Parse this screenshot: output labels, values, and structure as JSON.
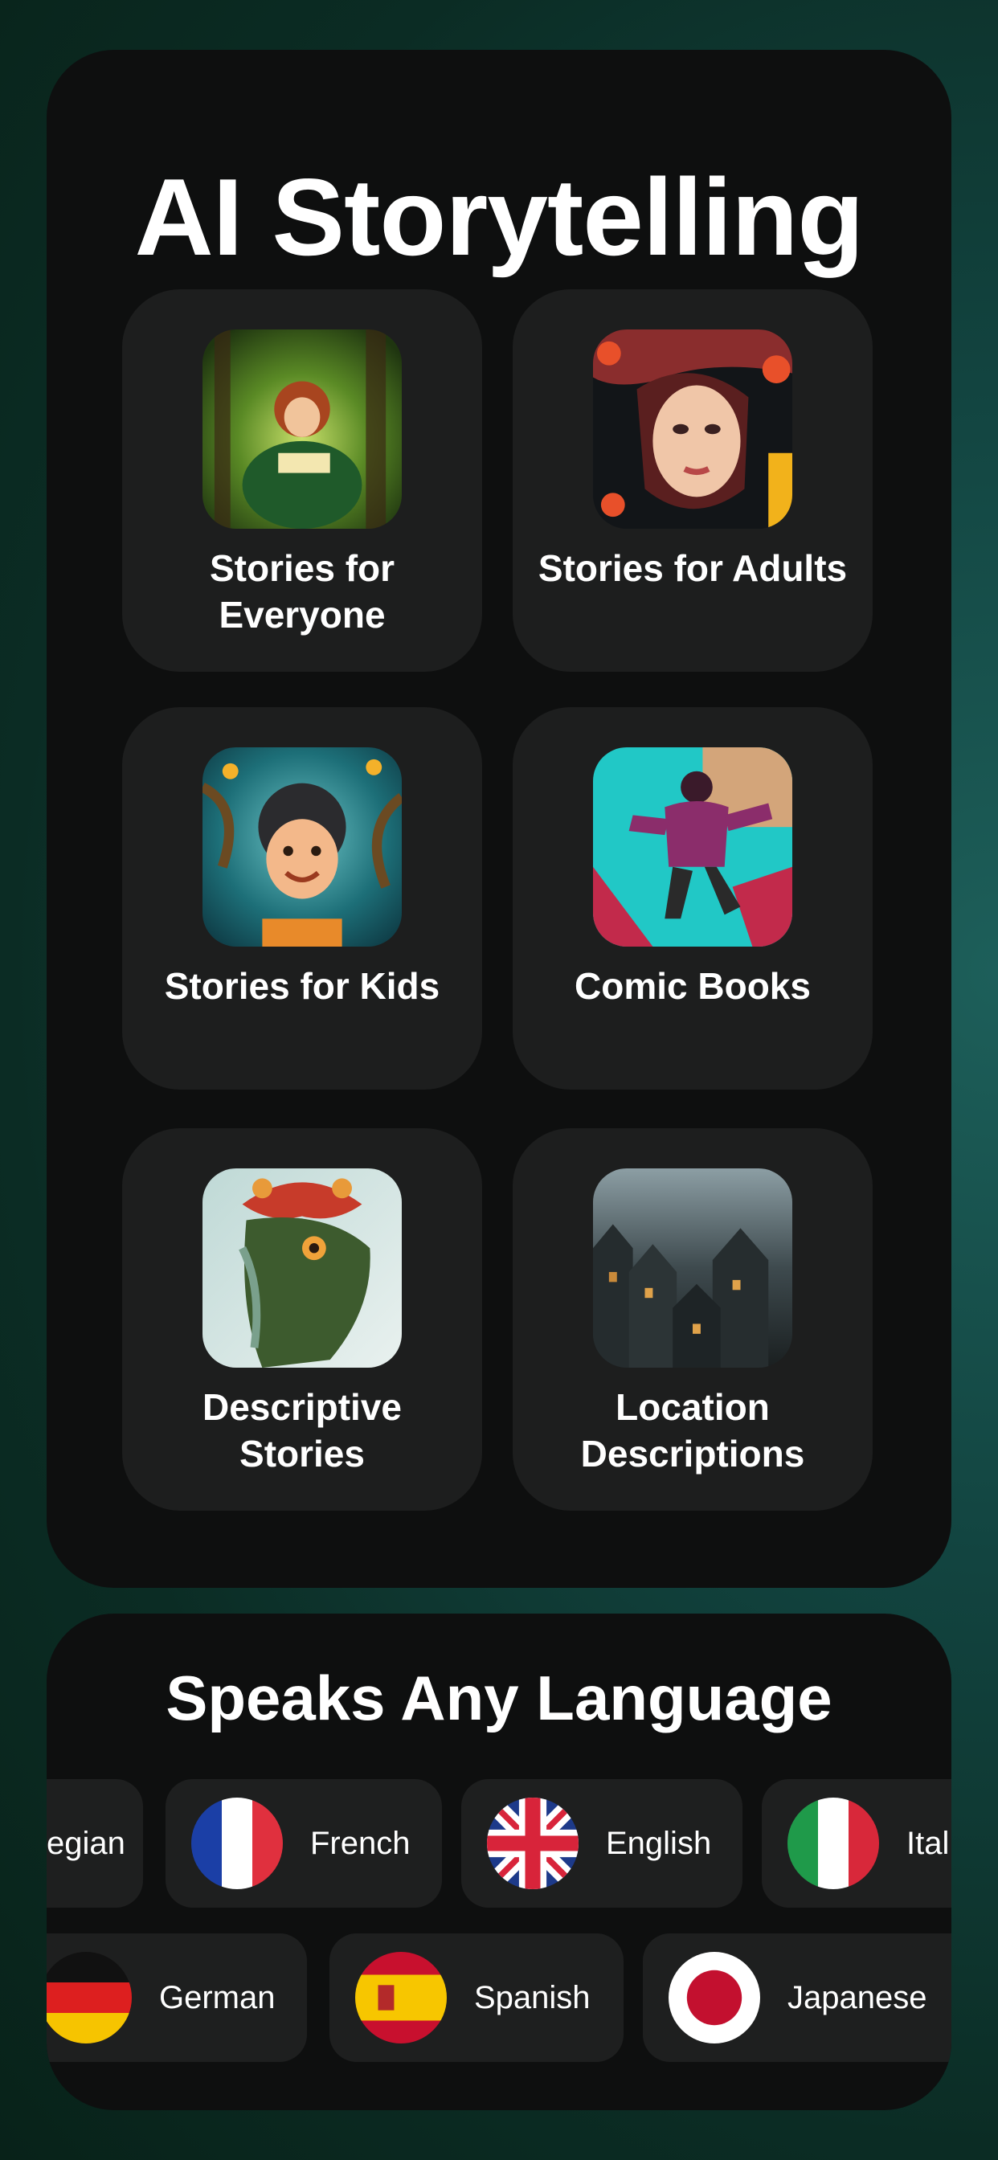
{
  "header": {
    "title": "AI Storytelling"
  },
  "categories": [
    {
      "label": "Stories for Everyone",
      "icon": "girl-reading-forest-image"
    },
    {
      "label": "Stories for Adults",
      "icon": "woman-portrait-image"
    },
    {
      "label": "Stories for Kids",
      "icon": "smiling-boy-image"
    },
    {
      "label": "Comic Books",
      "icon": "comic-hero-jumping-image"
    },
    {
      "label": "Descriptive Stories",
      "icon": "nature-face-image"
    },
    {
      "label": "Location Descriptions",
      "icon": "dark-village-image"
    }
  ],
  "languages": {
    "title": "Speaks Any Language",
    "row1": [
      {
        "label": "egian",
        "flag": "norway-flag-icon"
      },
      {
        "label": "French",
        "flag": "france-flag-icon"
      },
      {
        "label": "English",
        "flag": "uk-flag-icon"
      },
      {
        "label": "Ital",
        "flag": "italy-flag-icon"
      }
    ],
    "row2": [
      {
        "label": "German",
        "flag": "germany-flag-icon"
      },
      {
        "label": "Spanish",
        "flag": "spain-flag-icon"
      },
      {
        "label": "Japanese",
        "flag": "japan-flag-icon"
      }
    ]
  },
  "colors": {
    "background": "#0b2c24",
    "panel": "#0e0f0f",
    "card": "#1d1e1e"
  }
}
